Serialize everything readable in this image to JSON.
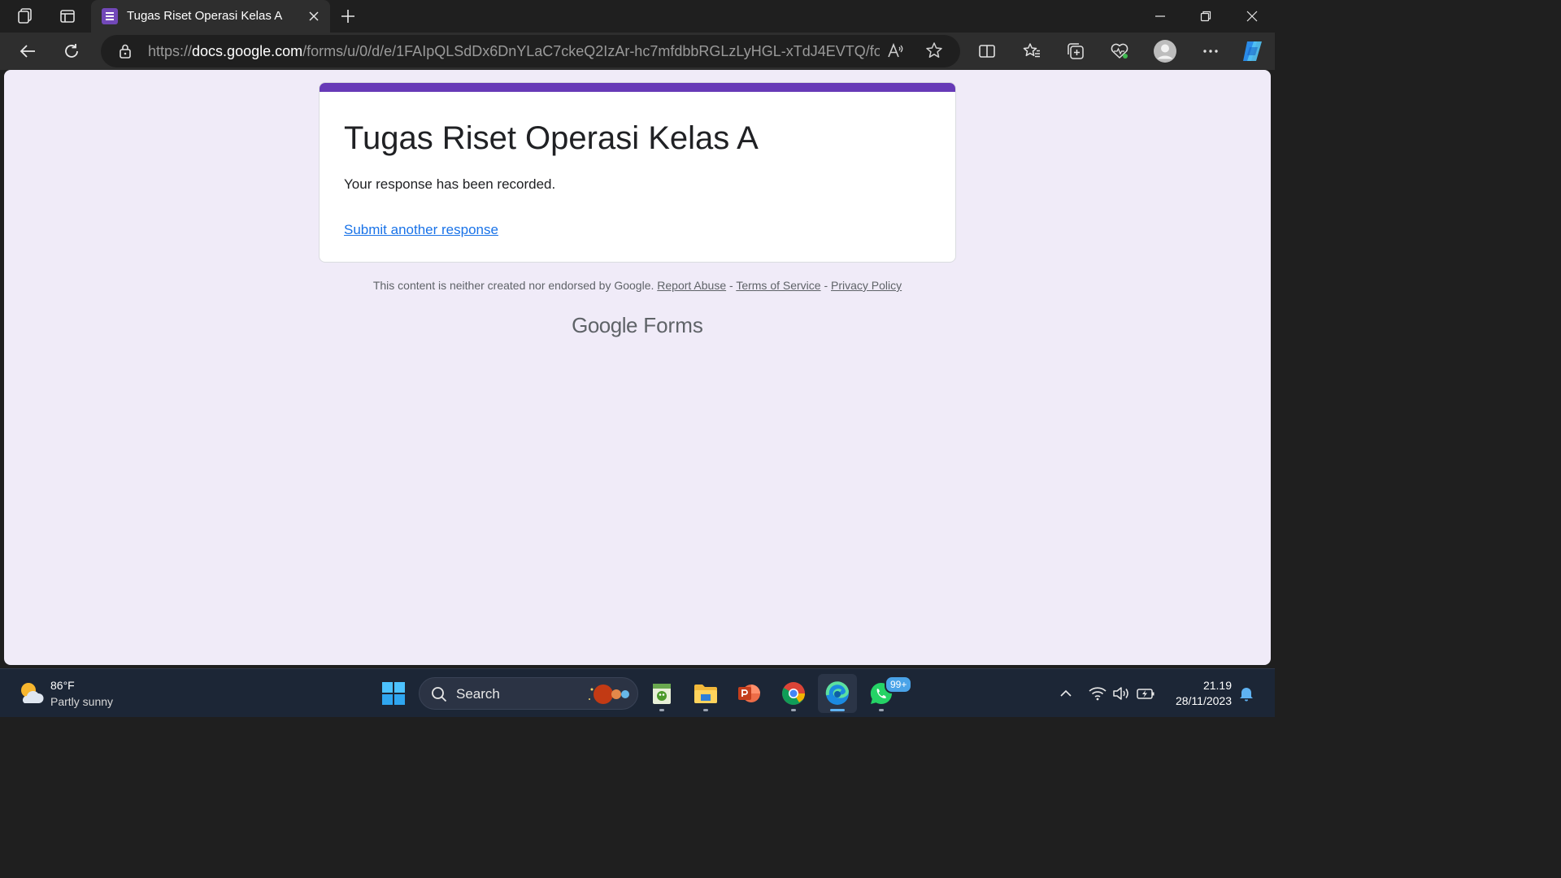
{
  "browser": {
    "tab": {
      "title": "Tugas Riset Operasi Kelas A"
    },
    "address": {
      "prefix": "https://",
      "host": "docs.google.com",
      "path": "/forms/u/0/d/e/1FAIpQLSdDx6DnYLaC7ckeQ2IzAr-hc7mfdbbRGLzLyHGL-xTdJ4EVTQ/formR..."
    },
    "read_aloud_glyph": "A̅",
    "accent": "#673ab7"
  },
  "form": {
    "title": "Tugas Riset Operasi Kelas A",
    "message": "Your response has been recorded.",
    "link": "Submit another response"
  },
  "footer": {
    "disclaimer": "This content is neither created nor endorsed by Google.",
    "report_abuse": "Report Abuse",
    "separator": "-",
    "terms": "Terms of Service",
    "privacy": "Privacy Policy",
    "logo_google": "Google",
    "logo_forms": "Forms"
  },
  "taskbar": {
    "weather": {
      "temp": "86°F",
      "desc": "Partly sunny"
    },
    "search": {
      "label": "Search"
    },
    "whatsapp_badge": "99+",
    "clock": {
      "time": "21.19",
      "date": "28/11/2023"
    }
  }
}
